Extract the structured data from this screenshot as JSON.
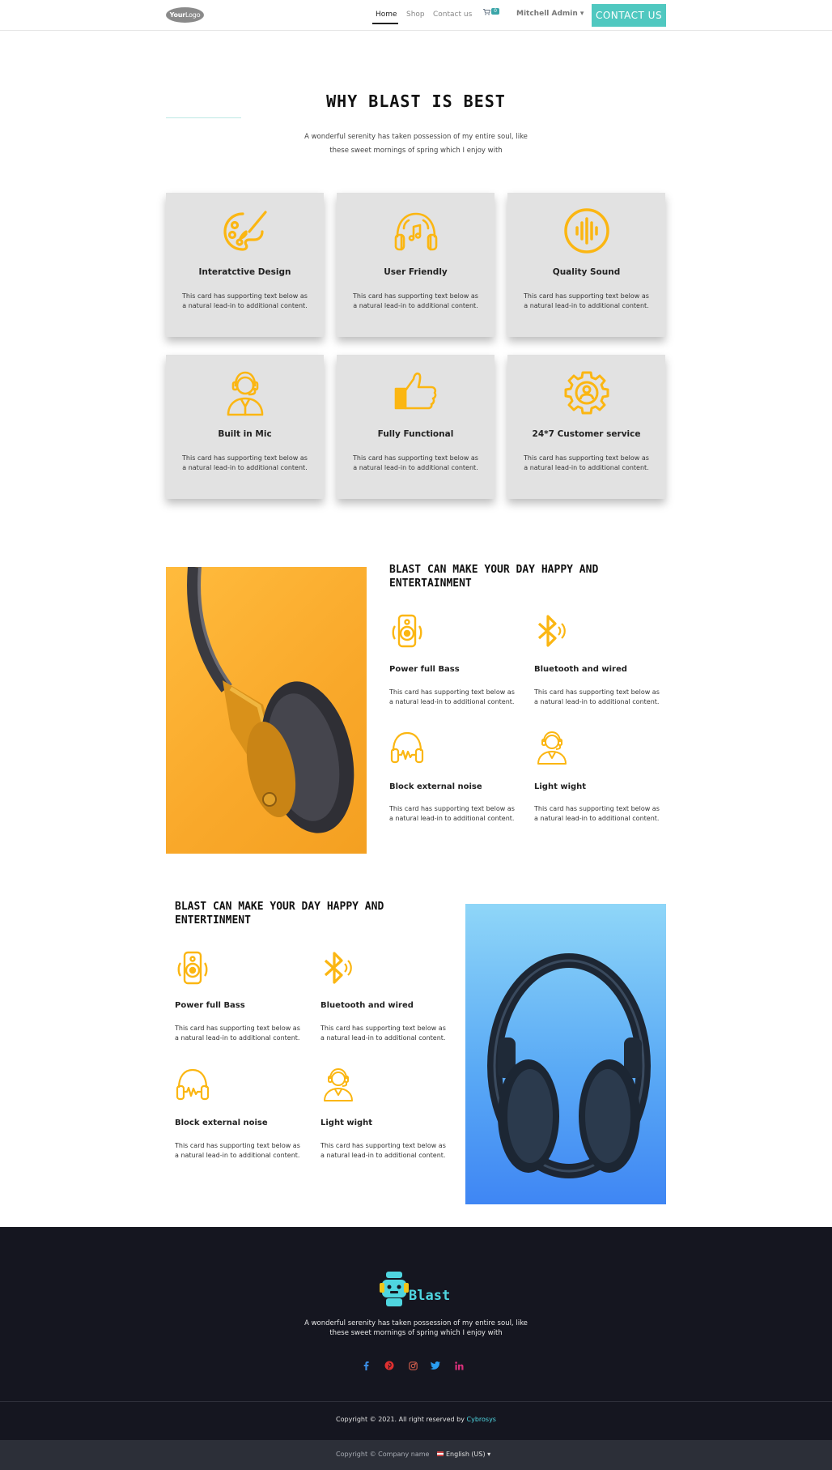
{
  "nav": {
    "logo_bold": "Your",
    "logo_light": "Logo",
    "links": [
      "Home",
      "Shop",
      "Contact us"
    ],
    "cart_count": "0",
    "user": "Mitchell Admin",
    "contact_button": "CONTACT US"
  },
  "why": {
    "title": "WHY BLAST IS BEST",
    "subtitle": "A wonderful serenity has taken possession of my entire soul, like these sweet mornings of spring which I enjoy with",
    "cards": [
      {
        "icon": "palette-icon",
        "title": "Interatctive Design",
        "text": "This card has supporting text below as a natural lead-in to additional content."
      },
      {
        "icon": "headphones-music-icon",
        "title": "User Friendly",
        "text": "This card has supporting text below as a natural lead-in to additional content."
      },
      {
        "icon": "sound-wave-icon",
        "title": "Quality Sound",
        "text": "This card has supporting text below as a natural lead-in to additional content."
      },
      {
        "icon": "headset-person-icon",
        "title": "Built in Mic",
        "text": "This card has supporting text below as a natural lead-in to additional content."
      },
      {
        "icon": "thumbs-up-icon",
        "title": "Fully Functional",
        "text": "This card has supporting text below as a natural lead-in to additional content."
      },
      {
        "icon": "gear-support-icon",
        "title": "24*7 Customer service",
        "text": "This card has supporting text below as a natural lead-in to additional content."
      }
    ]
  },
  "section2": {
    "title": "BLAST CAN MAKE YOUR DAY HAPPY AND ENTERTAINMENT",
    "features": [
      {
        "icon": "speaker-icon",
        "title": "Power full Bass",
        "text": "This card has supporting text below as a natural lead-in to additional content."
      },
      {
        "icon": "bluetooth-icon",
        "title": "Bluetooth and wired",
        "text": "This card has supporting text below as a natural lead-in to additional content."
      },
      {
        "icon": "noise-cancel-icon",
        "title": "Block external noise",
        "text": "This card has supporting text below as a natural lead-in to additional content."
      },
      {
        "icon": "headset-person-icon",
        "title": "Light wight",
        "text": "This card has supporting text below as a natural lead-in to additional content."
      }
    ]
  },
  "section3": {
    "title": "BLAST CAN MAKE YOUR DAY HAPPY AND ENTERTINMENT",
    "features": [
      {
        "icon": "speaker-icon",
        "title": "Power full Bass",
        "text": "This card has supporting text below as a natural lead-in to additional content."
      },
      {
        "icon": "bluetooth-icon",
        "title": "Bluetooth and wired",
        "text": "This card has supporting text below as a natural lead-in to additional content."
      },
      {
        "icon": "noise-cancel-icon",
        "title": "Block external noise",
        "text": "This card has supporting text below as a natural lead-in to additional content."
      },
      {
        "icon": "headset-person-icon",
        "title": "Light wight",
        "text": "This card has supporting text below as a natural lead-in to additional content."
      }
    ]
  },
  "footer": {
    "brand": "Blast",
    "text": "A wonderful serenity has taken possession of my entire soul, like these sweet mornings of spring which I enjoy with",
    "social": [
      "facebook-icon",
      "pinterest-icon",
      "instagram-icon",
      "twitter-icon",
      "linkedin-icon"
    ],
    "copyright_prefix": "Copyright © 2021. All right reserved by",
    "copyright_link": "Cybrosys",
    "bottom_copy": "Copyright © Company name",
    "language": "English (US)"
  },
  "colors": {
    "accent": "#50c8c0",
    "icon": "#fbb612",
    "footer_bg": "#151620",
    "card_bg": "#e2e2e2"
  }
}
